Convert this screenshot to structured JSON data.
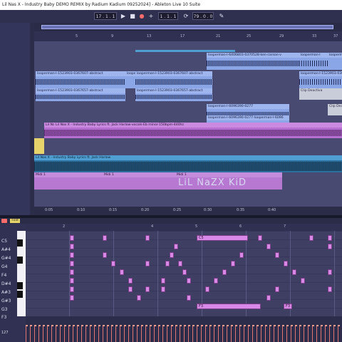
{
  "window": {
    "title": "Lil Nas X - Industry Baby DEMO REMIX by Radium Kadium 09252024] - Ableton Live 10 Suite"
  },
  "toolbar": {
    "position": "17 .  1 .  1",
    "loop_start": "1 .  1 .  1",
    "loop_length": "79 .  0 .  0",
    "play_icon": "play-icon",
    "stop_icon": "stop-icon",
    "record_icon": "record-icon"
  },
  "ruler": {
    "bars": [
      "5",
      "9",
      "13",
      "17",
      "21",
      "25",
      "29",
      "33",
      "37",
      "41"
    ]
  },
  "clips": {
    "looperman_a": "looperman-l-1523903-0367607-abstract",
    "looperman_b": "loope",
    "looperman_c": "looperman-l-1523903-0367607-abstract",
    "looperman_d": "looperman-l-1523903-0367657-abstract",
    "looperman_e": "looperman-l-1523903-036",
    "looperman_top": "looperman-l-6406803-0370528-ken-carson-v",
    "looperman_top2": "looperman-l",
    "looperman_top3": "looperman-l-1523903-0367657-abstract",
    "looperman_mid": "looperman-l-6096390-0277",
    "looperman_mid2": "looperman-l-6096390-0277-looperman-l-6096",
    "clip_deactivated": "Clip Deactiva",
    "vocals": "Lil Nas X - Industry Baby Lyrics ft. Jack Harlow-vocals-Eb minor-150bpm-440hz",
    "vocals_short": "Lil Nas X",
    "full_track": "Lil Nas X - Industry Baby Lyrics ft. Jack Harlow",
    "midi1": "Midi 1",
    "midi2": "Midi 1",
    "midi3": "Midi 1",
    "watermark": "LiL NaZX KiD"
  },
  "timebar": {
    "labels": [
      "0:05",
      "0:10",
      "0:15",
      "0:20",
      "0:25",
      "0:30",
      "0:35",
      "0:40"
    ]
  },
  "piano_roll": {
    "header": "Fold",
    "note_names": [
      "C5",
      "A#4",
      "G#4",
      "G4",
      "F4",
      "D#4",
      "A#3",
      "G#3",
      "G3",
      "F3"
    ],
    "note_c5_label": "C5",
    "note_f3_label": "F3",
    "note_f3b_label": "F3",
    "ruler": [
      "1",
      "2",
      "3",
      "4",
      "5",
      "6",
      "7"
    ],
    "velocity_value": "127"
  },
  "colors": {
    "audio_clip": "#8ba6e6",
    "audio_wave": "#1e2856",
    "vocal_clip": "#c07ad6",
    "full_clip": "#4f9fd2",
    "midi_clip": "#b678d1",
    "note": "#d889e8"
  }
}
